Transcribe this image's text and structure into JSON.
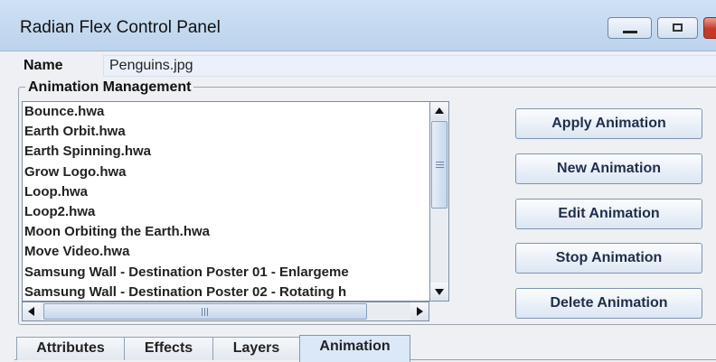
{
  "window": {
    "title": "Radian Flex Control Panel",
    "controls": [
      "minimize-icon",
      "maximize-icon",
      "close-icon"
    ],
    "close_glyph": "✕"
  },
  "name_row": {
    "label": "Name",
    "value": "Penguins.jpg"
  },
  "animation_group": {
    "title": "Animation Management",
    "items": [
      "Bounce.hwa",
      "Earth Orbit.hwa",
      "Earth Spinning.hwa",
      "Grow Logo.hwa",
      "Loop.hwa",
      "Loop2.hwa",
      "Moon Orbiting the Earth.hwa",
      "Move Video.hwa",
      "Samsung Wall - Destination Poster 01 - Enlargeme",
      "Samsung Wall - Destination Poster 02 - Rotating h"
    ],
    "buttons": {
      "apply": "Apply Animation",
      "new": "New Animation",
      "edit": "Edit Animation",
      "stop": "Stop Animation",
      "delete": "Delete Animation"
    }
  },
  "tabs": [
    {
      "label": "Attributes",
      "selected": false
    },
    {
      "label": "Effects",
      "selected": false
    },
    {
      "label": "Layers",
      "selected": false
    },
    {
      "label": "Animation",
      "selected": true
    }
  ],
  "colors": {
    "titlebar": "#c6daf0",
    "panel": "#eef0f3",
    "close_button": "#c4392a",
    "selected_tab": "#dbe8f8"
  }
}
